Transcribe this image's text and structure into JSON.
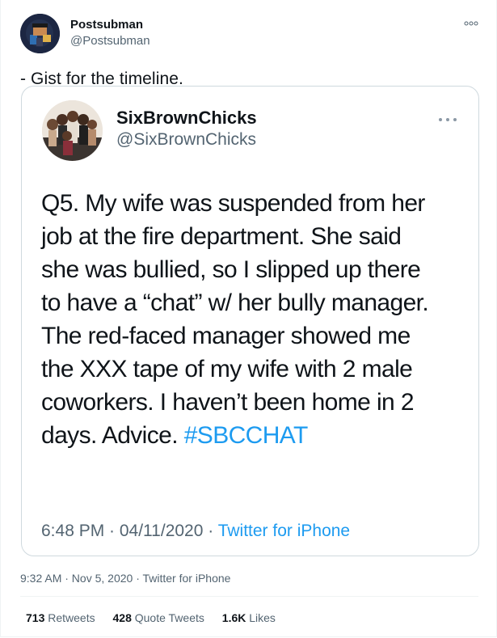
{
  "tweet": {
    "author": {
      "name": "Postsubman",
      "handle": "@Postsubman"
    },
    "text": "- Gist for the timeline.",
    "more_icon": "more-options-icon",
    "timestamp": "9:32 AM · Nov 5, 2020 · Twitter for iPhone",
    "stats": {
      "retweets_count": "713",
      "retweets_label": "Retweets",
      "quote_count": "428",
      "quote_label": "Quote Tweets",
      "likes_count": "1.6K",
      "likes_label": "Likes"
    }
  },
  "quoted": {
    "author": {
      "name": "SixBrownChicks",
      "handle": "@SixBrownChicks"
    },
    "lines": [
      "Q5. My wife was suspended from her",
      "job at the fire department. She said",
      "she was bullied, so I slipped up there",
      "to have a “chat” w/ her bully manager.",
      "The red-faced manager showed me",
      "the XXX tape of my wife with 2 male",
      "coworkers. I haven’t been home in 2"
    ],
    "last_line_text": "days. Advice. ",
    "hashtag": "#SBCCHAT",
    "meta_time": "6:48 PM · 04/11/2020 · ",
    "meta_source": "Twitter for iPhone"
  },
  "colors": {
    "accent": "#1d9bf0",
    "secondary_text": "#536471",
    "border": "#cfd9de"
  }
}
